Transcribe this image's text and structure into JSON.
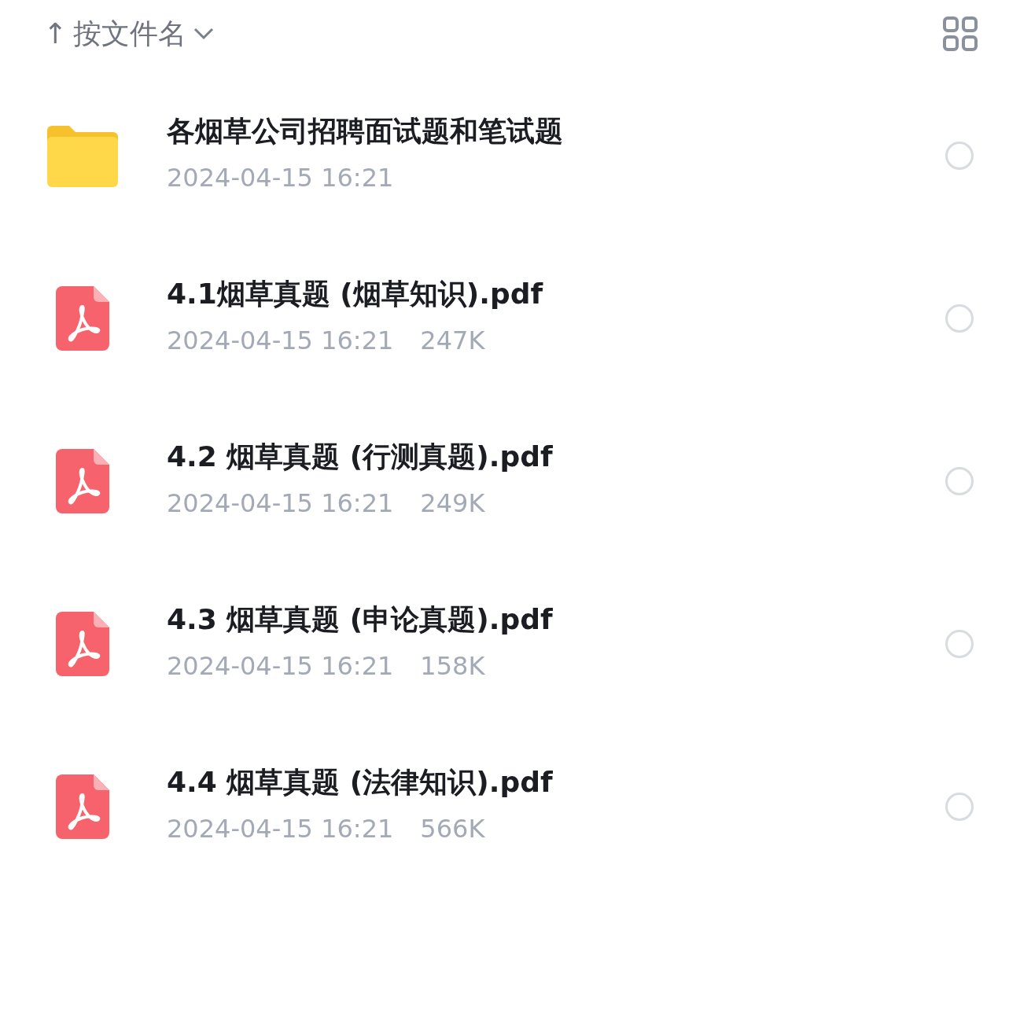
{
  "sort": {
    "arrow": "↑",
    "label": "按文件名"
  },
  "files": [
    {
      "kind": "folder",
      "name": "各烟草公司招聘面试题和笔试题",
      "date": "2024-04-15 16:21",
      "selected": false
    },
    {
      "kind": "pdf",
      "name": "4.1烟草真题 (烟草知识).pdf",
      "date": "2024-04-15 16:21",
      "size": "247K",
      "selected": false
    },
    {
      "kind": "pdf",
      "name": "4.2 烟草真题 (行测真题).pdf",
      "date": "2024-04-15 16:21",
      "size": "249K",
      "selected": false
    },
    {
      "kind": "pdf",
      "name": "4.3 烟草真题 (申论真题).pdf",
      "date": "2024-04-15 16:21",
      "size": "158K",
      "selected": false
    },
    {
      "kind": "pdf",
      "name": "4.4 烟草真题 (法律知识).pdf",
      "date": "2024-04-15 16:21",
      "size": "566K",
      "selected": false
    }
  ]
}
